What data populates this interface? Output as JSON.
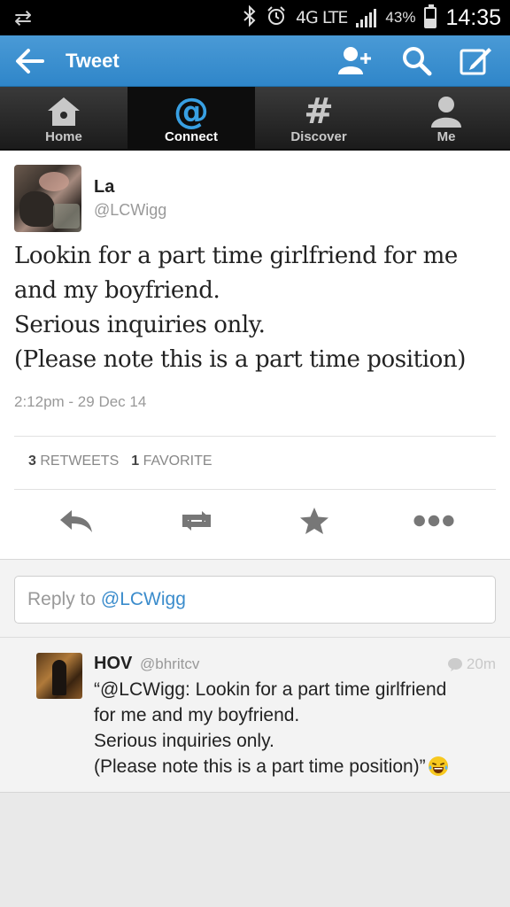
{
  "status_bar": {
    "sync_icon": "sync-arrows-icon",
    "network": "4G LTE",
    "battery_percent": "43%",
    "battery_level": 0.43,
    "time": "14:35"
  },
  "action_bar": {
    "title": "Tweet",
    "accent_color": "#3b8fd0"
  },
  "tabs": [
    {
      "label": "Home",
      "icon": "home-icon",
      "active": false
    },
    {
      "label": "Connect",
      "icon": "at-icon",
      "active": true
    },
    {
      "label": "Discover",
      "icon": "hash-icon",
      "active": false
    },
    {
      "label": "Me",
      "icon": "person-icon",
      "active": false
    }
  ],
  "tweet": {
    "author_name": "La",
    "author_handle": "@LCWigg",
    "text_lines": [
      "Lookin for a part time girlfriend for me",
      "and my boyfriend.",
      "Serious inquiries only.",
      "(Please note this is a part time position)"
    ],
    "timestamp": "2:12pm - 29 Dec 14",
    "retweets_count": "3",
    "retweets_label": "RETWEETS",
    "favorites_count": "1",
    "favorites_label": "FAVORITE"
  },
  "reply_box": {
    "prefix": "Reply to ",
    "mention": "@LCWigg"
  },
  "replies": [
    {
      "name": "HOV",
      "handle": "@bhritcv",
      "time": "20m",
      "text_lines": [
        "“@LCWigg: Lookin for a part time girlfriend",
        "for me and my boyfriend.",
        "Serious inquiries only.",
        "(Please note this is a part time position)”"
      ],
      "emoji": "laughing-tears-emoji"
    }
  ]
}
